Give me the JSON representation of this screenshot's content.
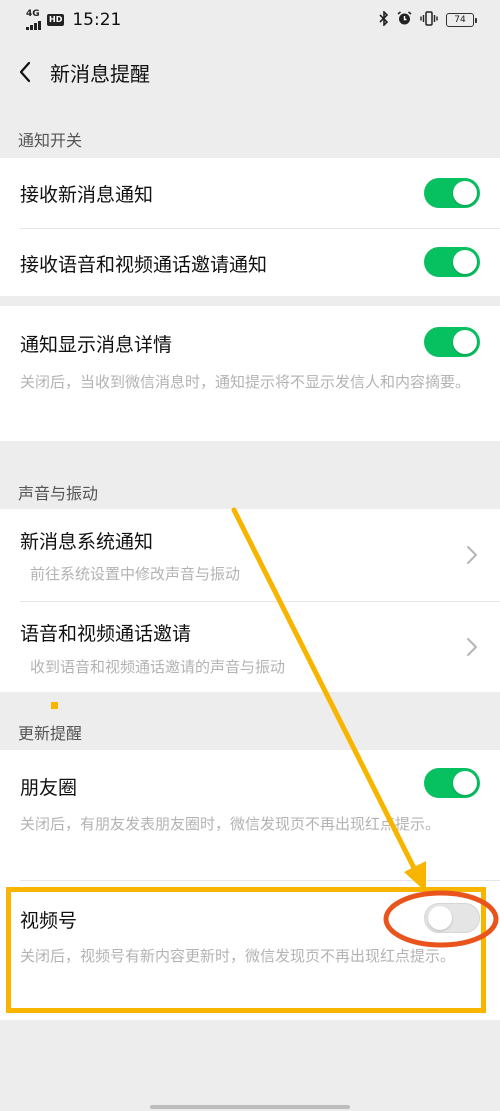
{
  "status_bar": {
    "network": "4G",
    "hd": "HD",
    "time": "15:21",
    "battery": "74",
    "icons": [
      "bluetooth-icon",
      "alarm-icon",
      "vibrate-icon",
      "battery-icon"
    ]
  },
  "nav": {
    "title": "新消息提醒",
    "back_icon": "chevron-left-icon"
  },
  "sections": {
    "notify_switch": "通知开关",
    "sound_vibration": "声音与振动",
    "update_reminder": "更新提醒"
  },
  "rows": {
    "receive_new_msg": {
      "title": "接收新消息通知",
      "toggle": "on"
    },
    "receive_call_invite": {
      "title": "接收语音和视频通话邀请通知",
      "toggle": "on"
    },
    "show_details": {
      "title": "通知显示消息详情",
      "desc": "关闭后，当收到微信消息时，通知提示将不显示发信人和内容摘要。",
      "toggle": "on"
    },
    "system_notify": {
      "title": "新消息系统通知",
      "desc": "前往系统设置中修改声音与振动"
    },
    "call_invite": {
      "title": "语音和视频通话邀请",
      "desc": "收到语音和视频通话邀请的声音与振动"
    },
    "moments": {
      "title": "朋友圈",
      "desc": "关闭后，有朋友发表朋友圈时，微信发现页不再出现红点提示。",
      "toggle": "on"
    },
    "channels": {
      "title": "视频号",
      "desc": "关闭后，视频号有新内容更新时，微信发现页不再出现红点提示。",
      "toggle": "off"
    }
  },
  "colors": {
    "toggle_on": "#07c160",
    "annotation_arrow": "#f7b500",
    "annotation_ellipse": "#e8541c"
  }
}
